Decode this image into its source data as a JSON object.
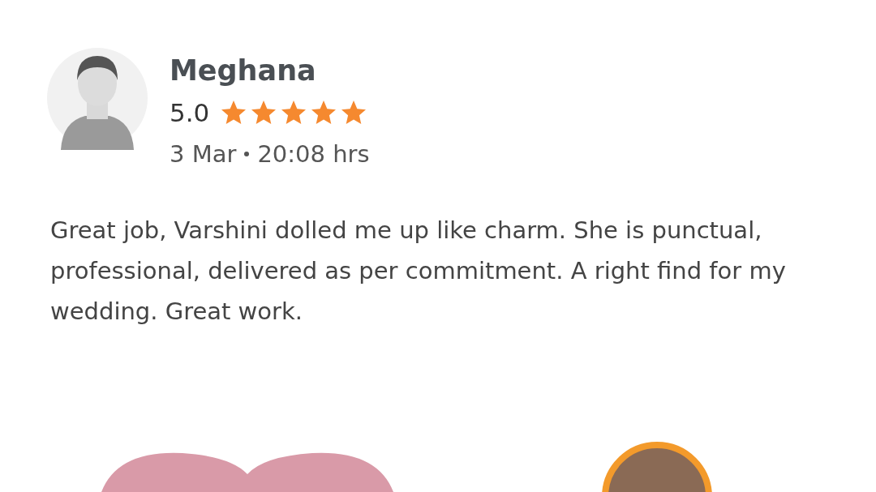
{
  "review": {
    "name": "Meghana",
    "rating": "5.0",
    "stars": 5,
    "date": "3 Mar",
    "time": "20:08 hrs",
    "text": "Great job, Varshini dolled me up like charm. She is punctual, professional, delivered as per commitment. A right find for my wedding. Great work."
  }
}
